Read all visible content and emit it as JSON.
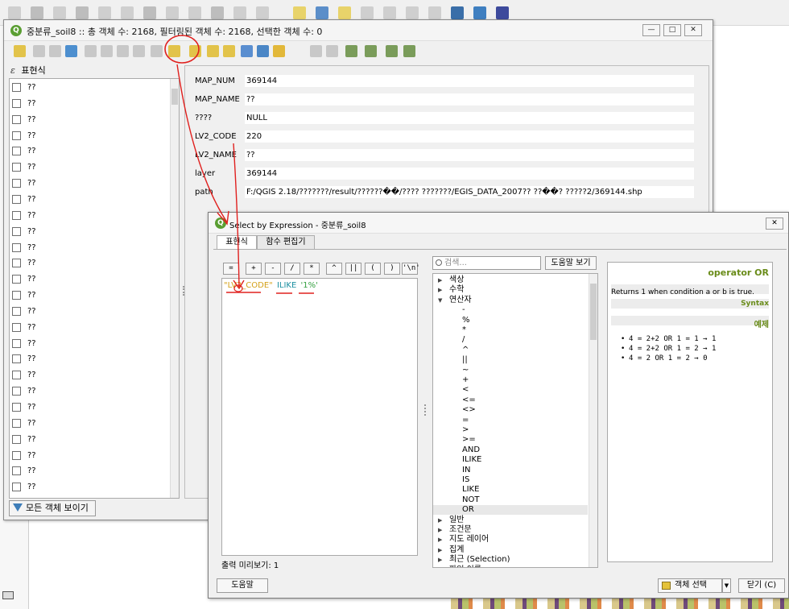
{
  "attribute_window": {
    "title": "중분류_soil8 :: 총 객체 수: 2168, 필터링된 객체 수: 2168, 선택한 객체 수: 0",
    "window_buttons": [
      "—",
      "□",
      "✕"
    ],
    "expression_label": "표현식",
    "expression_symbol": "ε",
    "field_items": [
      "??",
      "??",
      "??",
      "??",
      "??",
      "??",
      "??",
      "??",
      "??",
      "??",
      "??",
      "??",
      "??",
      "??",
      "??",
      "??",
      "??",
      "??",
      "??",
      "??",
      "??",
      "??",
      "??",
      "??",
      "??",
      "??"
    ],
    "show_all_button": "모든 객체 보이기",
    "form_fields": [
      {
        "label": "MAP_NUM",
        "value": "369144"
      },
      {
        "label": "MAP_NAME",
        "value": "??"
      },
      {
        "label": "????",
        "value": "NULL"
      },
      {
        "label": "LV2_CODE",
        "value": "220"
      },
      {
        "label": "LV2_NAME",
        "value": "??"
      },
      {
        "label": "layer",
        "value": "369144"
      },
      {
        "label": "path",
        "value": "F:/QGIS 2.18/???????/result/??????��/???? ???????/EGIS_DATA_2007?? ??��? ?????2/369144.shp"
      }
    ]
  },
  "select_dialog": {
    "title": "Select by Expression - 중분류_soil8",
    "close_glyph": "✕",
    "tabs": [
      "표현식",
      "함수 편집기"
    ],
    "operators": [
      "=",
      "+",
      "-",
      "/",
      "*",
      "^",
      "||",
      "(",
      ")",
      "'\\n'"
    ],
    "expression": {
      "field": "\"LV2_CODE\"",
      "operator": "ILIKE",
      "value": "'1%'"
    },
    "preview_label": "출력 미리보기: 1",
    "search_placeholder": "검색...",
    "help_button": "도움말 보기",
    "tree": [
      {
        "label": "색상",
        "arrow": "▶"
      },
      {
        "label": "수학",
        "arrow": "▶"
      },
      {
        "label": "연산자",
        "arrow": "▼"
      },
      {
        "label": "-",
        "child": true
      },
      {
        "label": "%",
        "child": true
      },
      {
        "label": "*",
        "child": true
      },
      {
        "label": "/",
        "child": true
      },
      {
        "label": "^",
        "child": true
      },
      {
        "label": "||",
        "child": true
      },
      {
        "label": "~",
        "child": true
      },
      {
        "label": "+",
        "child": true
      },
      {
        "label": "<",
        "child": true
      },
      {
        "label": "<=",
        "child": true
      },
      {
        "label": "<>",
        "child": true
      },
      {
        "label": "=",
        "child": true
      },
      {
        "label": ">",
        "child": true
      },
      {
        "label": ">=",
        "child": true
      },
      {
        "label": "AND",
        "child": true
      },
      {
        "label": "ILIKE",
        "child": true
      },
      {
        "label": "IN",
        "child": true
      },
      {
        "label": "IS",
        "child": true
      },
      {
        "label": "LIKE",
        "child": true
      },
      {
        "label": "NOT",
        "child": true
      },
      {
        "label": "OR",
        "child": true,
        "selected": true
      },
      {
        "label": "일반",
        "arrow": "▶"
      },
      {
        "label": "조건문",
        "arrow": "▶"
      },
      {
        "label": "지도 레이어",
        "arrow": "▶"
      },
      {
        "label": "집계",
        "arrow": "▶"
      },
      {
        "label": "최근 (Selection)",
        "arrow": "▶"
      },
      {
        "label": "파일 이름",
        "arrow": "▶"
      }
    ],
    "help_panel": {
      "title": "operator OR",
      "description": "Returns 1 when condition a or b is true.",
      "syntax_label": "Syntax",
      "examples_label": "예제",
      "examples": [
        "4 = 2+2 OR 1 = 1 → 1",
        "4 = 2+2 OR 1 = 2 → 1",
        "4 = 2 OR 1 = 2 → 0"
      ]
    },
    "buttons": {
      "help": "도움말",
      "select_features": "객체 선택",
      "dropdown_arrow": "▼",
      "close": "닫기 (C)"
    }
  },
  "colors": {
    "annotation": "#e0201e",
    "qgis_green": "#5a9e32",
    "field_token": "#d4a017",
    "operator_token": "#1a8fa0",
    "string_token": "#34a040",
    "help_heading": "#6a8c1a"
  }
}
